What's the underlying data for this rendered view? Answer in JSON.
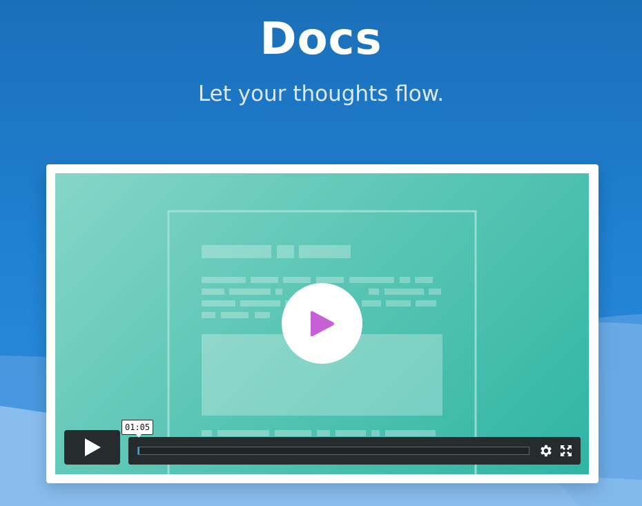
{
  "hero": {
    "title": "Docs",
    "subtitle": "Let your thoughts flow."
  },
  "video": {
    "poster_icon": "document-sketch",
    "play_icon": "play-icon",
    "play_icon_color": "#c85fd6",
    "controls": {
      "play_icon": "play-icon",
      "current_time": "01:05",
      "progress_fraction": 0.0,
      "settings_icon": "gear-icon",
      "fullscreen_icon": "fullscreen-icon"
    }
  },
  "colors": {
    "background": "#1f7fd0",
    "video_teal": "#5cc6b5",
    "controls_dark": "#262b2d",
    "progress_accent": "#3aa7e8"
  }
}
